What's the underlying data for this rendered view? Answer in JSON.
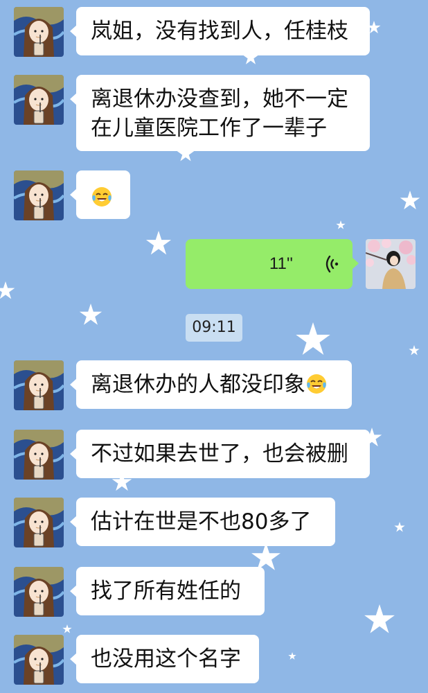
{
  "messages": [
    {
      "text": "岚姐，没有找到人，任桂枝"
    },
    {
      "line1": "离退休办没查到，她不一定",
      "line2": "在儿童医院工作了一辈子"
    },
    {
      "emoji": "tears-of-joy-emoji"
    },
    {
      "voice_duration": "11''"
    },
    {
      "text": "离退休办的人都没印象",
      "emoji": "tears-of-joy-emoji"
    },
    {
      "text": "不过如果去世了，也会被删"
    },
    {
      "text": "估计在世是不也80多了"
    },
    {
      "text": "找了所有姓任的"
    },
    {
      "text": "也没用这个名字"
    }
  ],
  "timestamp": "09:11",
  "colors": {
    "background": "#8fb7e6",
    "bubble_incoming": "#ffffff",
    "bubble_outgoing": "#95ec69",
    "timestamp_bg": "#c9def2"
  }
}
